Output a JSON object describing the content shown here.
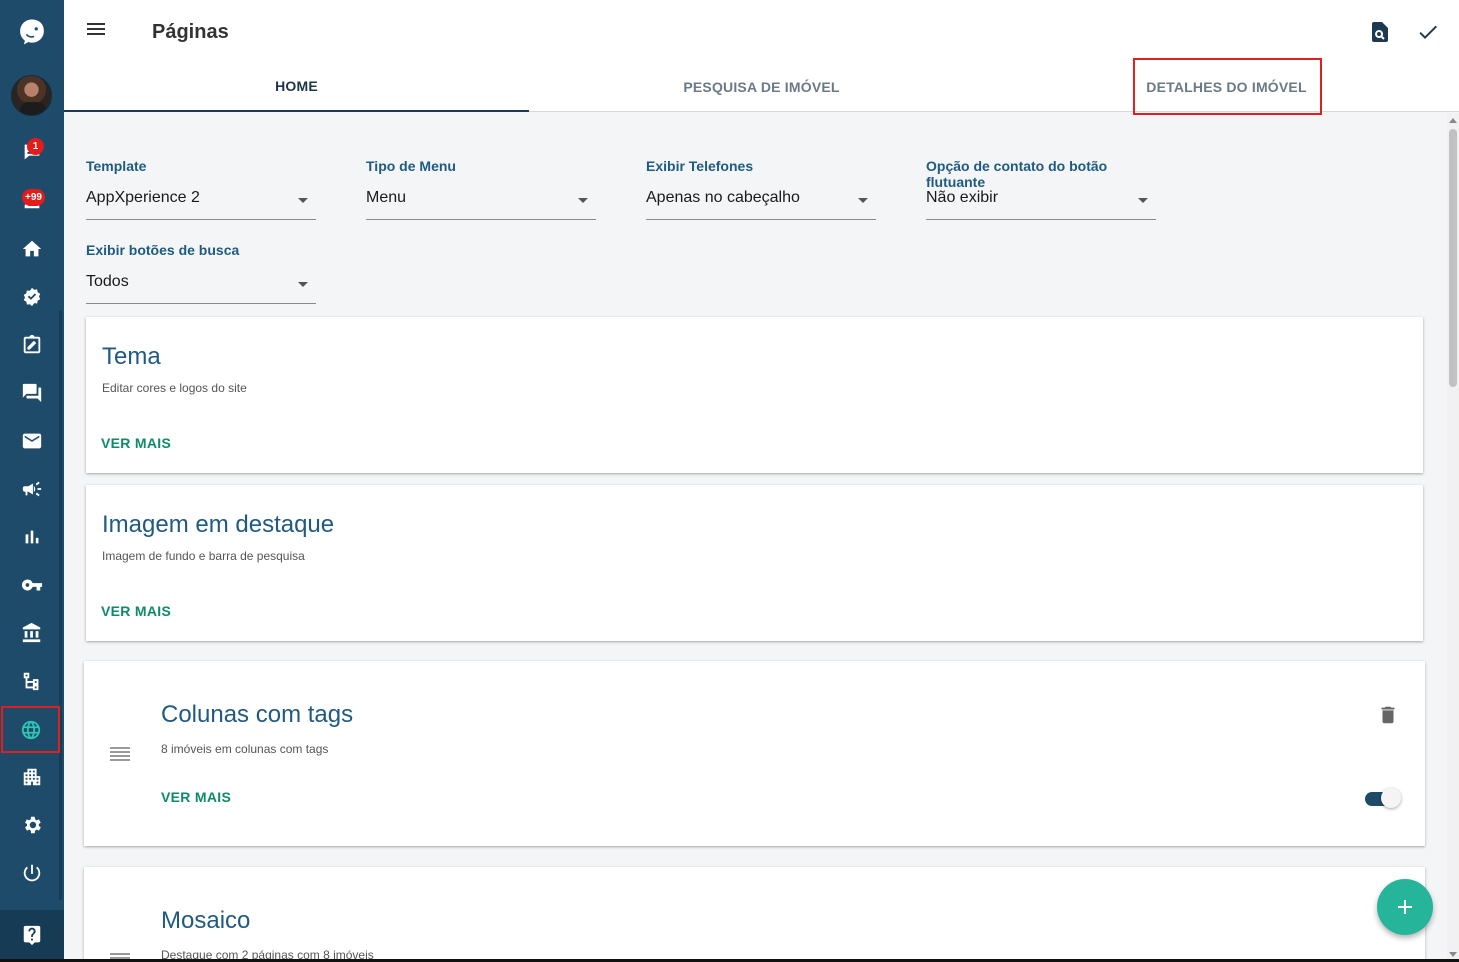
{
  "header": {
    "title": "Páginas",
    "tabs": [
      {
        "label": "HOME",
        "active": true
      },
      {
        "label": "PESQUISA DE IMÓVEL",
        "active": false
      },
      {
        "label": "DETALHES DO IMÓVEL",
        "active": false
      }
    ],
    "actions": [
      "preview-icon",
      "check-icon"
    ]
  },
  "sidebar": {
    "badges": {
      "notifications": "1",
      "leads": "+99"
    },
    "items": [
      "logo-icon",
      "avatar",
      "notifications-icon",
      "leads-icon",
      "home-icon",
      "tasks-icon",
      "contracts-icon",
      "chat-icon",
      "mail-icon",
      "campaign-icon",
      "reports-icon",
      "keys-icon",
      "bank-icon",
      "hierarchy-icon",
      "globe-icon",
      "properties-icon",
      "settings-icon",
      "power-icon",
      "help-icon"
    ],
    "active_item": "globe-icon"
  },
  "form": {
    "template": {
      "label": "Template",
      "value": "AppXperience 2"
    },
    "menu_type": {
      "label": "Tipo de Menu",
      "value": "Menu"
    },
    "show_phones": {
      "label": "Exibir Telefones",
      "value": "Apenas no cabeçalho"
    },
    "floating_contact": {
      "label": "Opção de contato do botão flutuante",
      "value": "Não exibir"
    },
    "search_buttons": {
      "label": "Exibir botões de busca",
      "value": "Todos"
    }
  },
  "cards": [
    {
      "title": "Tema",
      "subtitle": "Editar cores e logos do site",
      "link": "VER MAIS"
    },
    {
      "title": "Imagem em destaque",
      "subtitle": "Imagem de fundo e barra de pesquisa",
      "link": "VER MAIS"
    },
    {
      "title": "Colunas com tags",
      "subtitle": "8 imóveis em colunas com tags",
      "link": "VER MAIS",
      "enabled": true
    },
    {
      "title": "Mosaico",
      "subtitle": "Destaque com 2 páginas com 8 imóveis"
    }
  ],
  "colors": {
    "sidebar": "#1d4b69",
    "accent": "#26b59b",
    "title": "#1f5a82",
    "link": "#0f8a6c"
  }
}
